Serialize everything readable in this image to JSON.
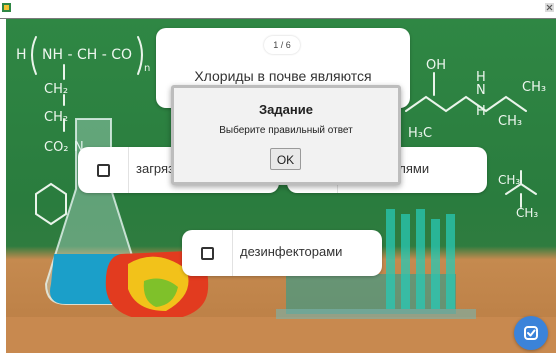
{
  "quiz": {
    "counter": "1 / 6",
    "question": "Хлориды в почве являются",
    "answers": [
      {
        "label": "загрязнителями"
      },
      {
        "label": "очистителями"
      },
      {
        "label": "дезинфекторами"
      }
    ]
  },
  "dialog": {
    "title": "Задание",
    "message": "Выберите правильный ответ",
    "ok_label": "OK"
  },
  "background": {
    "formula_left": [
      "H",
      "NH - CH - CO",
      "n",
      "CH₂",
      "CH₂",
      "CO₂",
      "N"
    ],
    "formula_right": [
      "OH",
      "H",
      "N",
      "CH₃",
      "H",
      "CH₃",
      "H₃C",
      "CH₃",
      "CH₃"
    ]
  },
  "icons": {
    "submit": "check-square-icon"
  },
  "colors": {
    "chalkboard": "#2f8744",
    "accent": "#3b83d9",
    "card": "#ffffff",
    "dialog": "#f2f2f2"
  }
}
